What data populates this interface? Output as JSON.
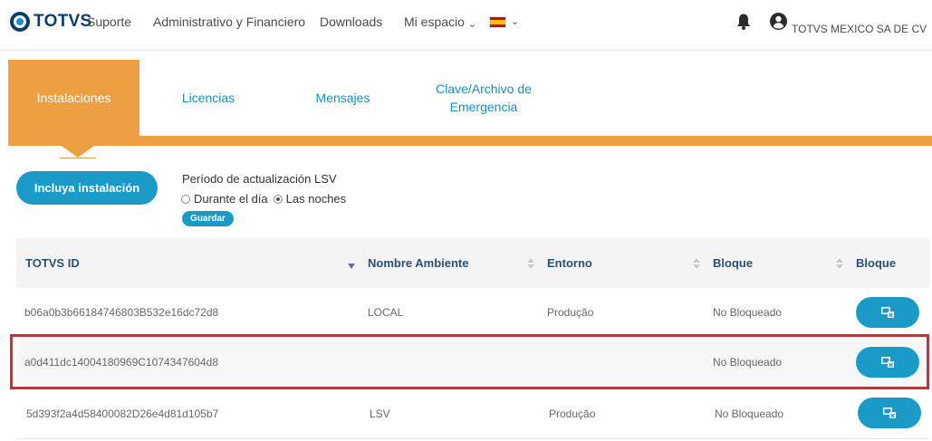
{
  "header": {
    "logo_text": "TOTVS",
    "nav": [
      {
        "label": "Suporte"
      },
      {
        "label": "Administrativo y Financiero"
      },
      {
        "label": "Downloads"
      },
      {
        "label": "Mi espacio"
      }
    ],
    "caret_glyph": "⌄",
    "language_flag": "spain-flag-icon",
    "company": "TOTVS MEXICO SA DE CV"
  },
  "tabs": [
    {
      "label": "Instalaciones",
      "active": true
    },
    {
      "label": "Licencias",
      "active": false
    },
    {
      "label": "Mensajes",
      "active": false
    },
    {
      "label": "Clave/Archivo de Emergencia",
      "active": false
    }
  ],
  "controls": {
    "include_button": "Incluya instalación",
    "lsv_title": "Período de actualización LSV",
    "radio_day": "Durante el día",
    "radio_night": "Las noches",
    "selected_option": "Las noches",
    "save_button": "Guardar"
  },
  "table": {
    "columns": [
      "TOTVS ID",
      "Nombre Ambiente",
      "Entorno",
      "Bloque",
      "Bloque"
    ],
    "rows": [
      {
        "id": "b06a0b3b66184746803B532e16dc72d8",
        "ambiente": "LOCAL",
        "entorno": "Produção",
        "bloqueo": "No Bloqueado"
      },
      {
        "id": "a0d411dc14004180969C1074347604d8",
        "ambiente": "",
        "entorno": "",
        "bloqueo": "No Bloqueado"
      },
      {
        "id": "5d393f2a4d58400082D26e4d81d105b7",
        "ambiente": "LSV",
        "entorno": "Produção",
        "bloqueo": "No Bloqueado"
      }
    ]
  },
  "colors": {
    "accent_orange": "#eda042",
    "primary_blue": "#1a9bc7",
    "highlight_red": "#e0252b"
  }
}
